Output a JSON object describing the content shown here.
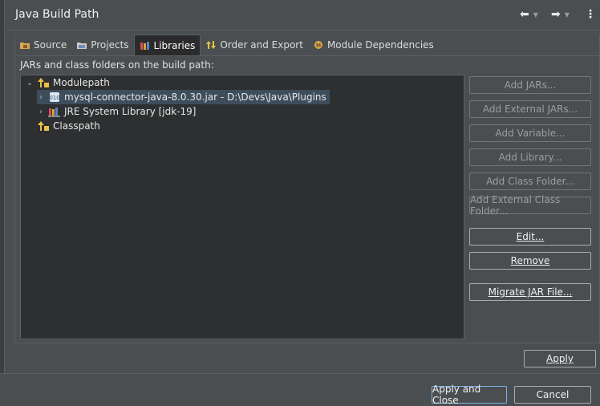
{
  "window": {
    "title": "Java Build Path"
  },
  "tabs": [
    {
      "label": "Source",
      "icon": "source-folder-icon"
    },
    {
      "label": "Projects",
      "icon": "projects-icon"
    },
    {
      "label": "Libraries",
      "icon": "libraries-icon",
      "active": true
    },
    {
      "label": "Order and Export",
      "icon": "order-export-icon"
    },
    {
      "label": "Module Dependencies",
      "icon": "module-dependencies-icon"
    }
  ],
  "section_label": "JARs and class folders on the build path:",
  "tree": {
    "items": [
      {
        "label": "Modulepath",
        "expanded": true,
        "icon": "modulepath-icon"
      },
      {
        "label": "mysql-connector-java-8.0.30.jar - D:\\Devs\\Java\\Plugins",
        "icon": "jar-icon",
        "selected": true
      },
      {
        "label": "JRE System Library [jdk-19]",
        "icon": "library-icon"
      },
      {
        "label": "Classpath",
        "icon": "classpath-icon"
      }
    ]
  },
  "buttons": {
    "add_jars": "Add JARs...",
    "add_external_jars": "Add External JARs...",
    "add_variable": "Add Variable...",
    "add_library": "Add Library...",
    "add_class_folder": "Add Class Folder...",
    "add_external_class_folder": "Add External Class Folder...",
    "edit": "Edit...",
    "remove": "Remove",
    "migrate_jar": "Migrate JAR File...",
    "apply": "Apply",
    "apply_and_close": "Apply and Close",
    "cancel": "Cancel"
  },
  "colors": {
    "background": "#4a4e50",
    "tree_background": "#2d2f30",
    "selection": "#3e4d5c",
    "accent": "#7fb0e6"
  }
}
